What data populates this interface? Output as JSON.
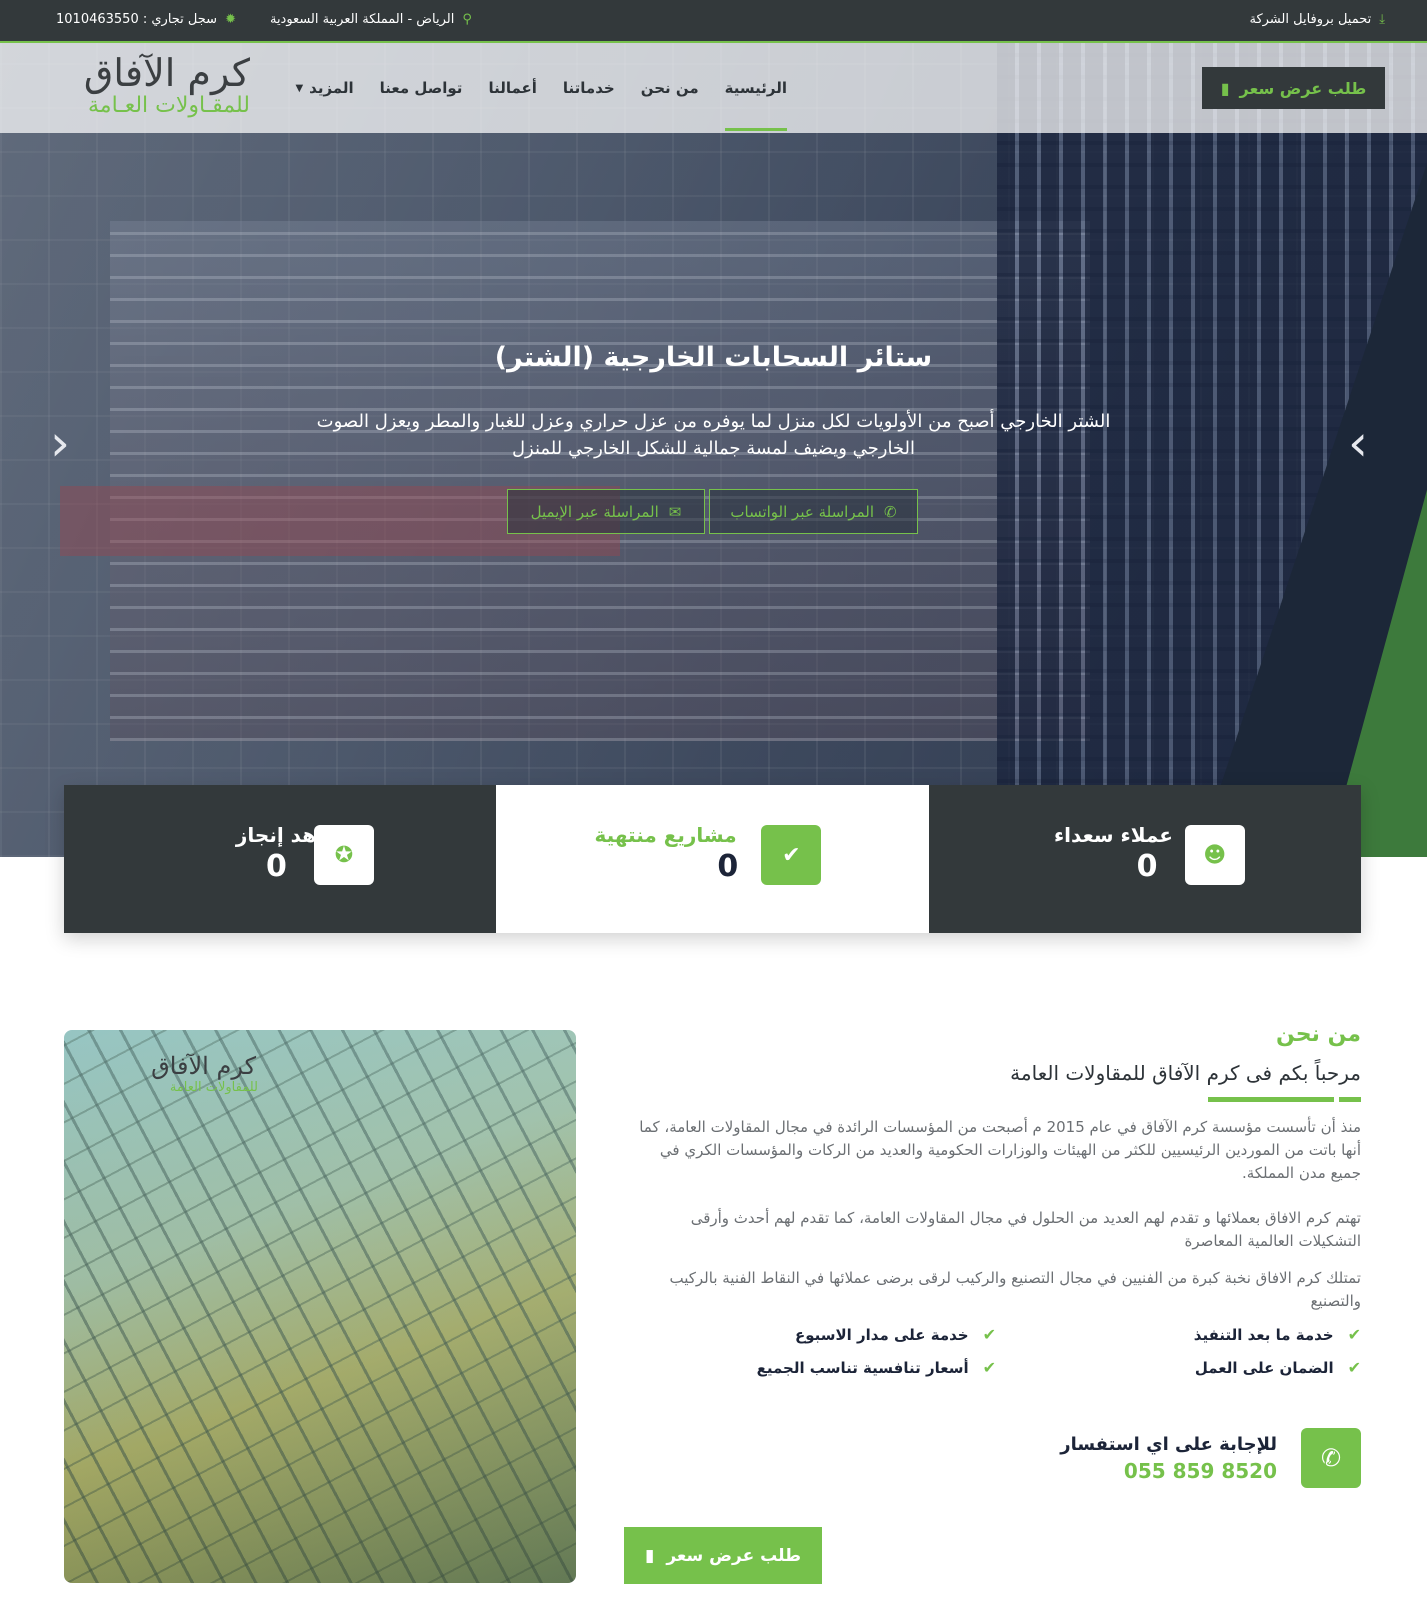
{
  "topbar": {
    "location": "الرياض - المملكة العربية السعودية",
    "commercial_register": "سجل تجاري : 1010463550",
    "download_profile": "تحميل بروفايل الشركة"
  },
  "logo": {
    "line1": "كرم الآفاق",
    "line2": "للمقـاولات العـامة"
  },
  "nav": {
    "items": [
      {
        "label": "الرئيسية",
        "active": true
      },
      {
        "label": "من نحن"
      },
      {
        "label": "خدماتنا"
      },
      {
        "label": "أعمالنا"
      },
      {
        "label": "تواصل معنا"
      },
      {
        "label": "المزيد"
      }
    ],
    "quote_button": "طلب عرض سعر"
  },
  "hero": {
    "title": "ستائر السحابات الخارجية (الشتر)",
    "text": "الشتر الخارجي أصبح من الأولويات لكل منزل لما يوفره من عزل حراري وعزل للغبار والمطر ويعزل الصوت الخارجي ويضيف لمسة جمالية للشكل الخارجي للمنزل",
    "whatsapp_button": "المراسلة عبر الواتساب",
    "email_button": "المراسلة عبر الإيميل",
    "prev_arrow": "‹",
    "next_arrow": "›"
  },
  "stats": [
    {
      "label": "مشاهد إنجاز",
      "value": "0",
      "icon": "award-icon"
    },
    {
      "label": "مشاريع منتهية",
      "value": "0",
      "icon": "check-icon"
    },
    {
      "label": "عملاء سعداء",
      "value": "0",
      "icon": "users-icon"
    }
  ],
  "about": {
    "image_watermark_line1": "كرم الآفاق",
    "image_watermark_line2": "للمقاولات العامة",
    "heading": "من نحن",
    "subheading": "مرحباً بكم فى كرم الآفاق للمقاولات العامة",
    "paragraph1": "منذ أن تأسست مؤسسة كرم الآفاق في عام 2015 م أصبحت من المؤسسات الرائدة في مجال المقاولات العامة، كما أنها باتت من الموردين الرئيسيين للكثر من الهيئات والوزارات الحكومية والعديد من الركات والمؤسسات الكري في جميع مدن المملكة.",
    "paragraph2": "تهتم كرم الافاق بعملائها و تقدم لهم العديد من الحلول في مجال المقاولات العامة، كما تقدم لهم أحدث وأرقى التشكيلات العالمية المعاصرة",
    "paragraph3": "تمتلك كرم الافاق نخبة كبرة من الفنيين في مجال التصنيع والركيب لرقى برضى عملائها في النقاط الفنية بالركيب والتصنيع",
    "features": [
      "خدمة ما بعد التنفيذ",
      "خدمة على مدار الاسبوع",
      "الضمان على العمل",
      "أسعار تنافسية تناسب الجميع"
    ],
    "contact_question": "للإجابة على اي استفسار",
    "phone": "055 859 8520",
    "quote_button": "طلب عرض سعر"
  },
  "colors": {
    "accent": "#76c14b",
    "dark": "#33393b",
    "navy": "#1c2438"
  }
}
